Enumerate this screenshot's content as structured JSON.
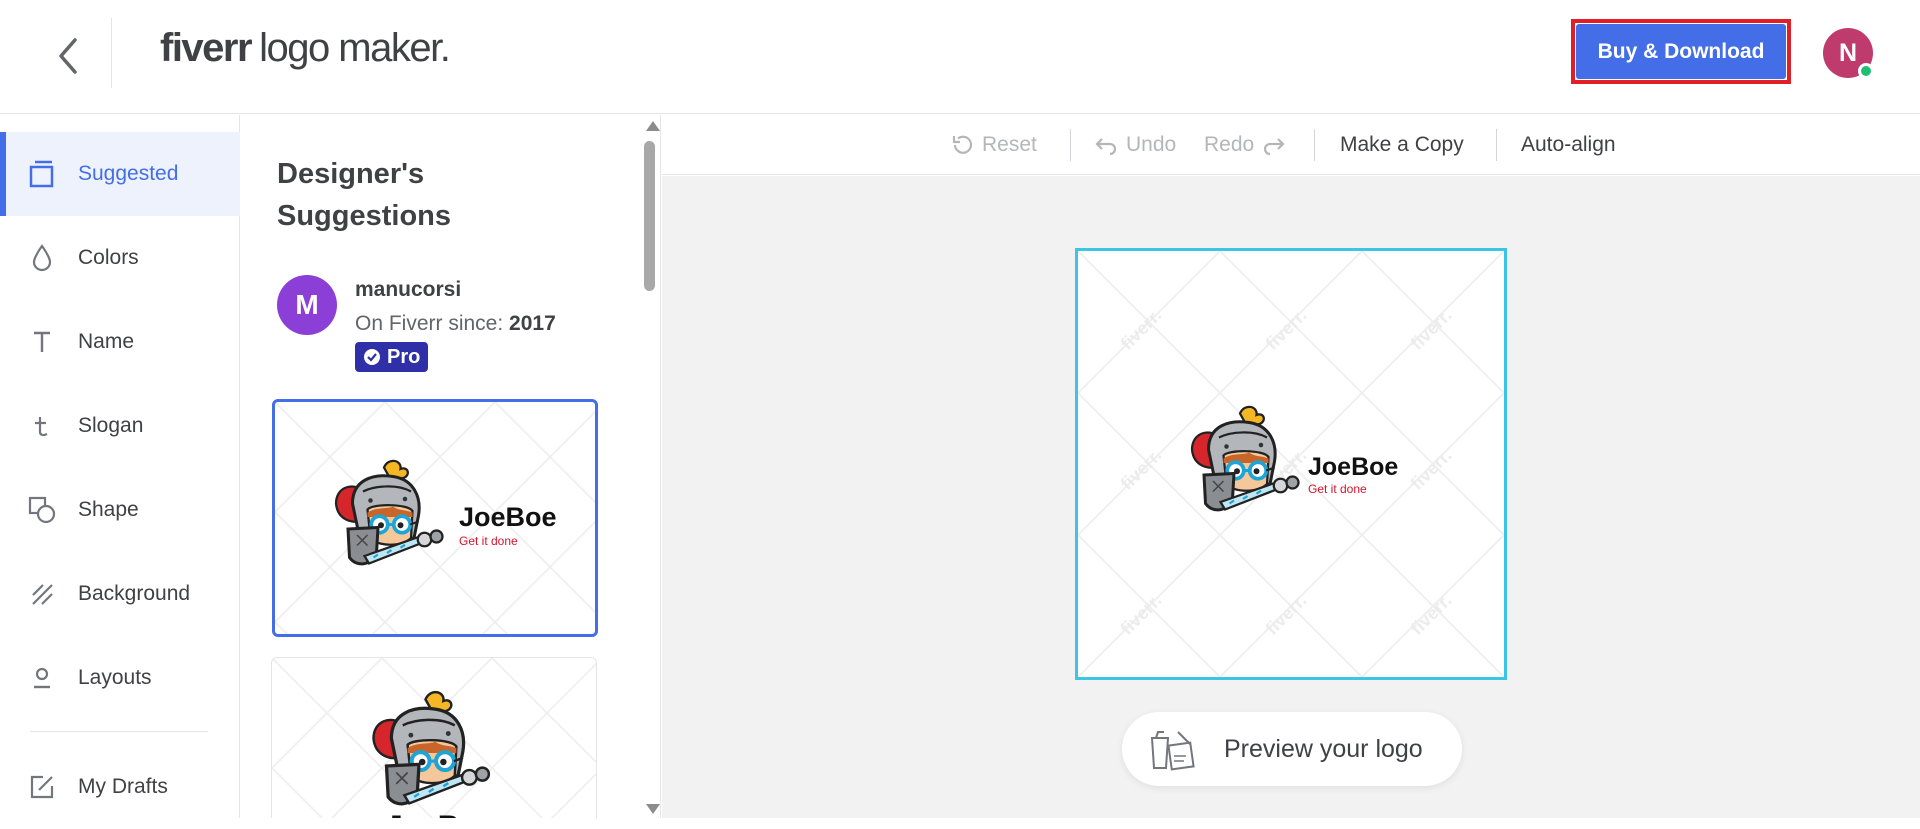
{
  "header": {
    "logo_brand": "fiverr",
    "logo_rest": "logo maker.",
    "buy_label": "Buy & Download",
    "avatar_initial": "N"
  },
  "sidebar": {
    "items": [
      {
        "label": "Suggested",
        "icon": "suggested-icon",
        "active": true
      },
      {
        "label": "Colors",
        "icon": "droplet-icon"
      },
      {
        "label": "Name",
        "icon": "text-icon"
      },
      {
        "label": "Slogan",
        "icon": "slogan-icon"
      },
      {
        "label": "Shape",
        "icon": "shape-icon"
      },
      {
        "label": "Background",
        "icon": "background-icon"
      },
      {
        "label": "Layouts",
        "icon": "layouts-icon"
      },
      {
        "label": "My Drafts",
        "icon": "drafts-icon"
      }
    ]
  },
  "panel": {
    "title": "Designer's Suggestions",
    "designer": {
      "initial": "M",
      "name": "manucorsi",
      "since_label": "On Fiverr since: ",
      "since_year": "2017",
      "badge": "Pro"
    }
  },
  "logo": {
    "name": "JoeBoe",
    "slogan": "Get it done",
    "watermark": "fiverr."
  },
  "toolbar": {
    "reset": "Reset",
    "undo": "Undo",
    "redo": "Redo",
    "copy": "Make a Copy",
    "align": "Auto-align"
  },
  "canvas": {
    "preview_label": "Preview your logo"
  },
  "colors": {
    "accent": "#446ee7",
    "highlight": "#e01f26",
    "frame": "#3ac6e4",
    "avatar": "#bf3b6e",
    "designer_avatar": "#8b3fd6",
    "online": "#1dbf73",
    "slogan": "#d4142b"
  }
}
